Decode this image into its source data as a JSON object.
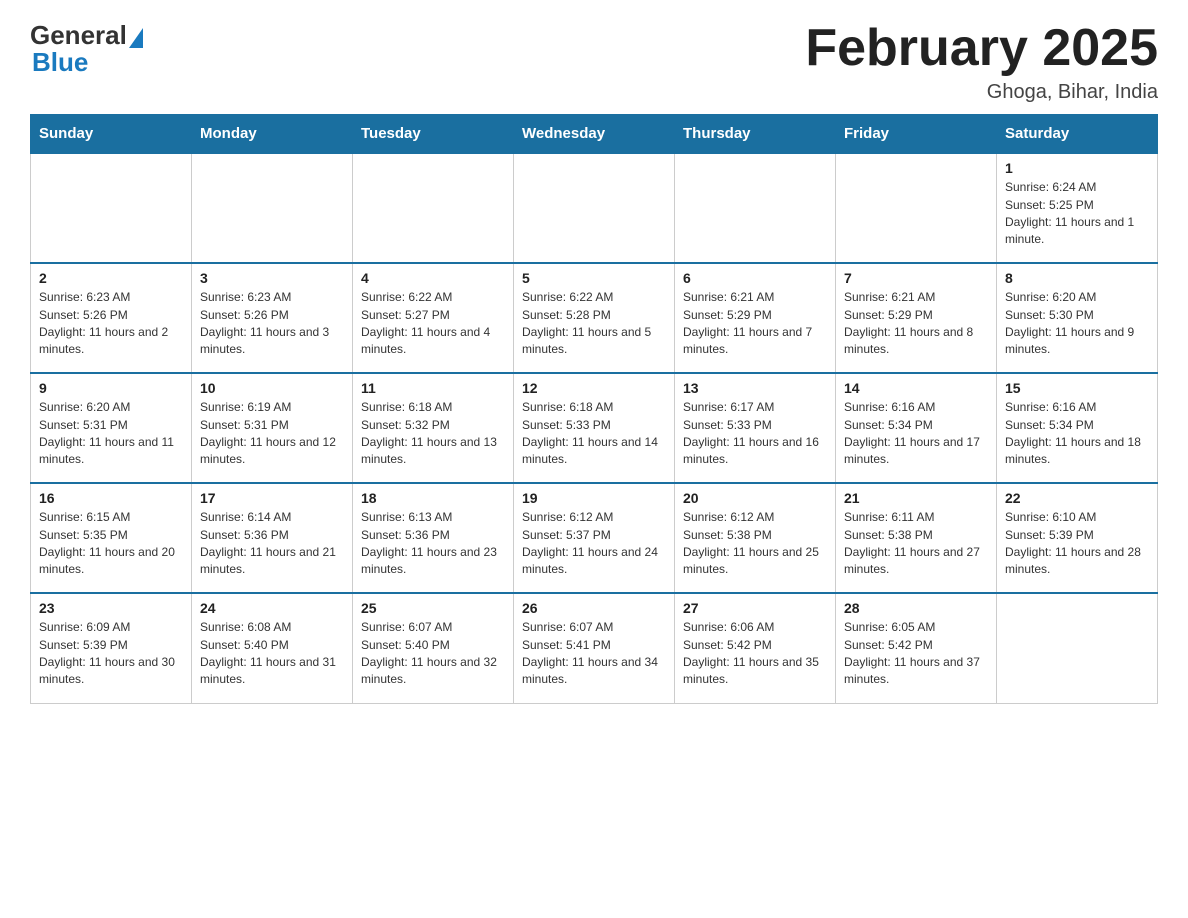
{
  "logo": {
    "general": "General",
    "blue": "Blue"
  },
  "title": "February 2025",
  "location": "Ghoga, Bihar, India",
  "weekdays": [
    "Sunday",
    "Monday",
    "Tuesday",
    "Wednesday",
    "Thursday",
    "Friday",
    "Saturday"
  ],
  "weeks": [
    [
      {
        "day": "",
        "sunrise": "",
        "sunset": "",
        "daylight": ""
      },
      {
        "day": "",
        "sunrise": "",
        "sunset": "",
        "daylight": ""
      },
      {
        "day": "",
        "sunrise": "",
        "sunset": "",
        "daylight": ""
      },
      {
        "day": "",
        "sunrise": "",
        "sunset": "",
        "daylight": ""
      },
      {
        "day": "",
        "sunrise": "",
        "sunset": "",
        "daylight": ""
      },
      {
        "day": "",
        "sunrise": "",
        "sunset": "",
        "daylight": ""
      },
      {
        "day": "1",
        "sunrise": "Sunrise: 6:24 AM",
        "sunset": "Sunset: 5:25 PM",
        "daylight": "Daylight: 11 hours and 1 minute."
      }
    ],
    [
      {
        "day": "2",
        "sunrise": "Sunrise: 6:23 AM",
        "sunset": "Sunset: 5:26 PM",
        "daylight": "Daylight: 11 hours and 2 minutes."
      },
      {
        "day": "3",
        "sunrise": "Sunrise: 6:23 AM",
        "sunset": "Sunset: 5:26 PM",
        "daylight": "Daylight: 11 hours and 3 minutes."
      },
      {
        "day": "4",
        "sunrise": "Sunrise: 6:22 AM",
        "sunset": "Sunset: 5:27 PM",
        "daylight": "Daylight: 11 hours and 4 minutes."
      },
      {
        "day": "5",
        "sunrise": "Sunrise: 6:22 AM",
        "sunset": "Sunset: 5:28 PM",
        "daylight": "Daylight: 11 hours and 5 minutes."
      },
      {
        "day": "6",
        "sunrise": "Sunrise: 6:21 AM",
        "sunset": "Sunset: 5:29 PM",
        "daylight": "Daylight: 11 hours and 7 minutes."
      },
      {
        "day": "7",
        "sunrise": "Sunrise: 6:21 AM",
        "sunset": "Sunset: 5:29 PM",
        "daylight": "Daylight: 11 hours and 8 minutes."
      },
      {
        "day": "8",
        "sunrise": "Sunrise: 6:20 AM",
        "sunset": "Sunset: 5:30 PM",
        "daylight": "Daylight: 11 hours and 9 minutes."
      }
    ],
    [
      {
        "day": "9",
        "sunrise": "Sunrise: 6:20 AM",
        "sunset": "Sunset: 5:31 PM",
        "daylight": "Daylight: 11 hours and 11 minutes."
      },
      {
        "day": "10",
        "sunrise": "Sunrise: 6:19 AM",
        "sunset": "Sunset: 5:31 PM",
        "daylight": "Daylight: 11 hours and 12 minutes."
      },
      {
        "day": "11",
        "sunrise": "Sunrise: 6:18 AM",
        "sunset": "Sunset: 5:32 PM",
        "daylight": "Daylight: 11 hours and 13 minutes."
      },
      {
        "day": "12",
        "sunrise": "Sunrise: 6:18 AM",
        "sunset": "Sunset: 5:33 PM",
        "daylight": "Daylight: 11 hours and 14 minutes."
      },
      {
        "day": "13",
        "sunrise": "Sunrise: 6:17 AM",
        "sunset": "Sunset: 5:33 PM",
        "daylight": "Daylight: 11 hours and 16 minutes."
      },
      {
        "day": "14",
        "sunrise": "Sunrise: 6:16 AM",
        "sunset": "Sunset: 5:34 PM",
        "daylight": "Daylight: 11 hours and 17 minutes."
      },
      {
        "day": "15",
        "sunrise": "Sunrise: 6:16 AM",
        "sunset": "Sunset: 5:34 PM",
        "daylight": "Daylight: 11 hours and 18 minutes."
      }
    ],
    [
      {
        "day": "16",
        "sunrise": "Sunrise: 6:15 AM",
        "sunset": "Sunset: 5:35 PM",
        "daylight": "Daylight: 11 hours and 20 minutes."
      },
      {
        "day": "17",
        "sunrise": "Sunrise: 6:14 AM",
        "sunset": "Sunset: 5:36 PM",
        "daylight": "Daylight: 11 hours and 21 minutes."
      },
      {
        "day": "18",
        "sunrise": "Sunrise: 6:13 AM",
        "sunset": "Sunset: 5:36 PM",
        "daylight": "Daylight: 11 hours and 23 minutes."
      },
      {
        "day": "19",
        "sunrise": "Sunrise: 6:12 AM",
        "sunset": "Sunset: 5:37 PM",
        "daylight": "Daylight: 11 hours and 24 minutes."
      },
      {
        "day": "20",
        "sunrise": "Sunrise: 6:12 AM",
        "sunset": "Sunset: 5:38 PM",
        "daylight": "Daylight: 11 hours and 25 minutes."
      },
      {
        "day": "21",
        "sunrise": "Sunrise: 6:11 AM",
        "sunset": "Sunset: 5:38 PM",
        "daylight": "Daylight: 11 hours and 27 minutes."
      },
      {
        "day": "22",
        "sunrise": "Sunrise: 6:10 AM",
        "sunset": "Sunset: 5:39 PM",
        "daylight": "Daylight: 11 hours and 28 minutes."
      }
    ],
    [
      {
        "day": "23",
        "sunrise": "Sunrise: 6:09 AM",
        "sunset": "Sunset: 5:39 PM",
        "daylight": "Daylight: 11 hours and 30 minutes."
      },
      {
        "day": "24",
        "sunrise": "Sunrise: 6:08 AM",
        "sunset": "Sunset: 5:40 PM",
        "daylight": "Daylight: 11 hours and 31 minutes."
      },
      {
        "day": "25",
        "sunrise": "Sunrise: 6:07 AM",
        "sunset": "Sunset: 5:40 PM",
        "daylight": "Daylight: 11 hours and 32 minutes."
      },
      {
        "day": "26",
        "sunrise": "Sunrise: 6:07 AM",
        "sunset": "Sunset: 5:41 PM",
        "daylight": "Daylight: 11 hours and 34 minutes."
      },
      {
        "day": "27",
        "sunrise": "Sunrise: 6:06 AM",
        "sunset": "Sunset: 5:42 PM",
        "daylight": "Daylight: 11 hours and 35 minutes."
      },
      {
        "day": "28",
        "sunrise": "Sunrise: 6:05 AM",
        "sunset": "Sunset: 5:42 PM",
        "daylight": "Daylight: 11 hours and 37 minutes."
      },
      {
        "day": "",
        "sunrise": "",
        "sunset": "",
        "daylight": ""
      }
    ]
  ]
}
